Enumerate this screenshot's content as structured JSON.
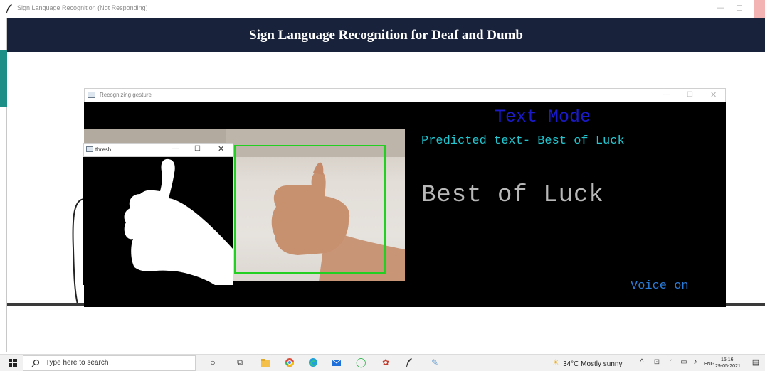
{
  "main_window": {
    "title": "Sign Language Recognition (Not Responding)",
    "heading": "Sign Language Recognition for Deaf and Dumb",
    "header_color": "#18223a"
  },
  "gesture_window": {
    "title": "Recognizing gesture",
    "mode_label": "Text Mode",
    "predicted_text": "Predicted text- Best of Luck",
    "recognized_text": "Best of Luck",
    "voice_status": "Voice on",
    "colors": {
      "mode": "#1a1ac8",
      "predicted": "#21c6d0",
      "recognized": "#b8b8b8",
      "voice": "#2a7bd8",
      "roi_box": "#22d022"
    }
  },
  "thresh_window": {
    "title": "thresh"
  },
  "taskbar": {
    "search_placeholder": "Type here to search",
    "weather": "34°C  Mostly sunny",
    "language": "ENG",
    "time": "15:16",
    "date": "29-05-2021",
    "pinned_icons": [
      "cortana-icon",
      "task-view-icon",
      "file-explorer-icon",
      "chrome-icon",
      "edge-icon",
      "mail-icon",
      "circle-app-icon",
      "game-icon",
      "feather-app-icon",
      "paint-icon"
    ]
  }
}
